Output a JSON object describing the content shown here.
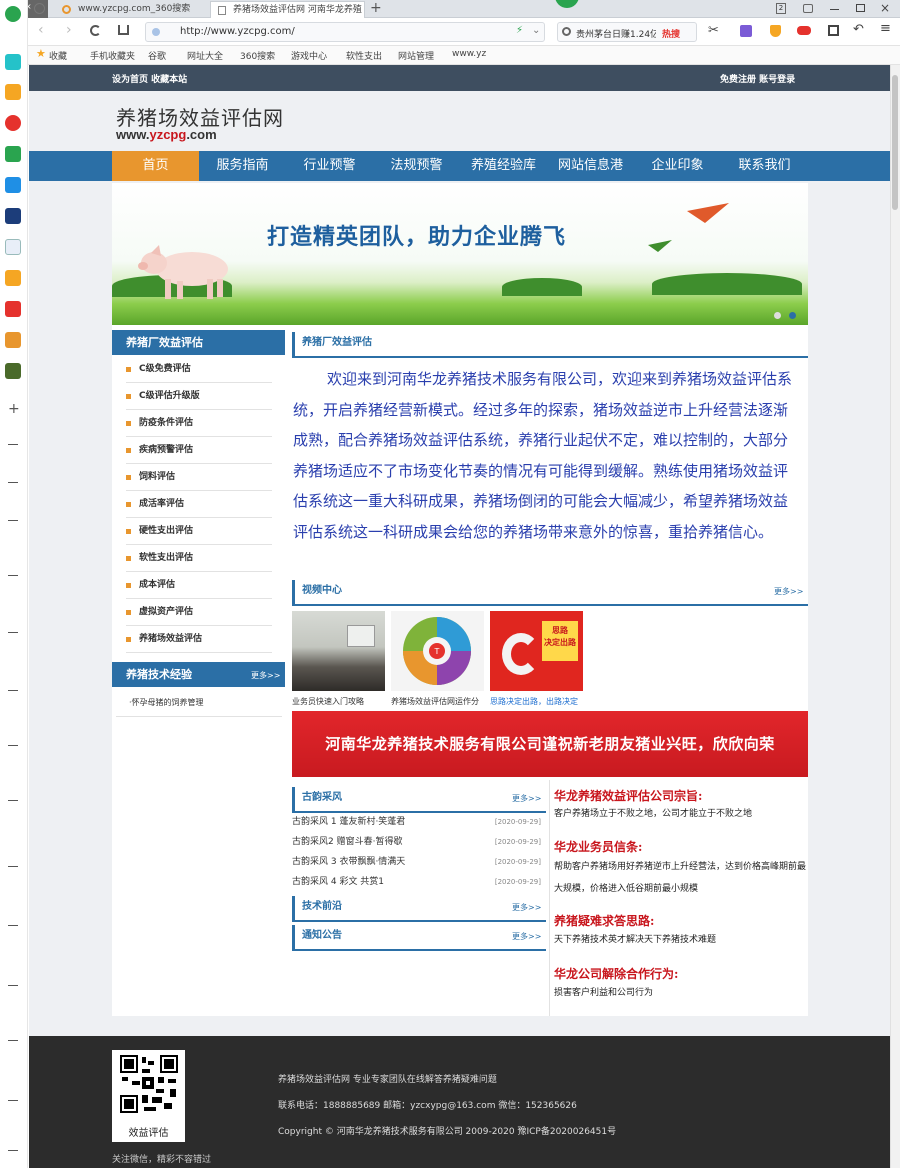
{
  "browser": {
    "tabs": [
      {
        "label": "www.yzcpg.com_360搜索",
        "active": false
      },
      {
        "label": "养猪场效益评估网 河南华龙养殖",
        "active": true
      }
    ],
    "window_size": "1360 × 695",
    "url": "http://www.yzcpg.com/",
    "search_text": "贵州茅台日赚1.24亿",
    "hot_label": "热搜",
    "bookmarks": [
      "收藏",
      "手机收藏夹",
      "谷歌",
      "网址大全",
      "360搜索",
      "游戏中心",
      "软性支出",
      "网站管理",
      "www.yz"
    ],
    "tab_count": "2"
  },
  "site": {
    "topbar": {
      "left": "设为首页  收藏本站",
      "right": "免费注册  账号登录"
    },
    "logo": {
      "title": "养猪场效益评估网",
      "url_prefix": "www.",
      "url_brand": "yzcpg",
      "url_suffix": ".com"
    },
    "nav": [
      "首页",
      "服务指南",
      "行业预警",
      "法规预警",
      "养殖经验库",
      "网站信息港",
      "企业印象",
      "联系我们"
    ],
    "banner_text": "打造精英团队，助力企业腾飞",
    "left_menu_title": "养猪厂效益评估",
    "left_menu": [
      "C级免费评估",
      "C级评估升级版",
      "防疫条件评估",
      "疾病预警评估",
      "饲料评估",
      "成活率评估",
      "硬性支出评估",
      "软性支出评估",
      "成本评估",
      "虚拟资产评估",
      "养猪场效益评估"
    ],
    "tech_title": "养猪技术经验",
    "more": "更多>>",
    "tech_items": [
      "·怀孕母猪的饲养管理"
    ],
    "intro_title": "养猪厂效益评估",
    "intro_text": "欢迎来到河南华龙养猪技术服务有限公司，欢迎来到养猪场效益评估系统，开启养猪经营新模式。经过多年的探索，猪场效益逆市上升经营法逐渐成熟，配合养猪场效益评估系统，养猪行业起伏不定，难以控制的，大部分养猪场适应不了市场变化节奏的情况有可能得到缓解。熟练使用猪场效益评估系统这一重大科研成果，养猪场倒闭的可能会大幅减少，希望养猪场效益评估系统这一科研成果会给您的养猪场带来意外的惊喜，重拾养猪信心。",
    "video_title": "视频中心",
    "videos": [
      {
        "caption": "业务员快速入门攻略"
      },
      {
        "caption": "养猪场效益评估网运作分"
      },
      {
        "caption": "思路决定出路，出路决定"
      }
    ],
    "video_art": {
      "circle_center": "T",
      "badge_top": "思路",
      "badge_bottom": "决定出路"
    },
    "red_banner": "河南华龙养猪技术服务有限公司谨祝新老朋友猪业兴旺，欣欣向荣",
    "guyun_title": "古韵采风",
    "guyun_items": [
      {
        "title": "古韵采风 1 蓬友新村·笑蓬君",
        "date": "[2020-09-29]"
      },
      {
        "title": "古韵采风2 赠窗斗春·暂得歇",
        "date": "[2020-09-29]"
      },
      {
        "title": "古韵采风 3 衣带飘飘·情满天",
        "date": "[2020-09-29]"
      },
      {
        "title": "古韵采风 4 彩文 共赏1",
        "date": "[2020-09-29]"
      }
    ],
    "tech_front_title": "技术前沿",
    "notice_title": "通知公告",
    "right_blocks": [
      {
        "heading": "华龙养猪效益评估公司宗旨:",
        "text": "客户养猪场立于不败之地，公司才能立于不败之地"
      },
      {
        "heading": "华龙业务员信条:",
        "text": "帮助客户养猪场用好养猪逆市上升经营法，达到价格高峰期前最大规模，价格进入低谷期前最小规模"
      },
      {
        "heading": "养猪疑难求答思路:",
        "text": "天下养猪技术英才解决天下养猪技术难题"
      },
      {
        "heading": "华龙公司解除合作行为:",
        "text": "损害客户利益和公司行为"
      }
    ],
    "footer": {
      "qr_label": "效益评估",
      "follow": "关注微信，精彩不容错过",
      "line1": "养猪场效益评估网  专业专家团队在线解答养猪疑难问题",
      "line2": "联系电话：1888885689  邮箱：yzcxypg@163.com  微信：152365626",
      "line3": "Copyright © 河南华龙养猪技术服务有限公司 2009-2020  豫ICP备2020026451号"
    }
  }
}
